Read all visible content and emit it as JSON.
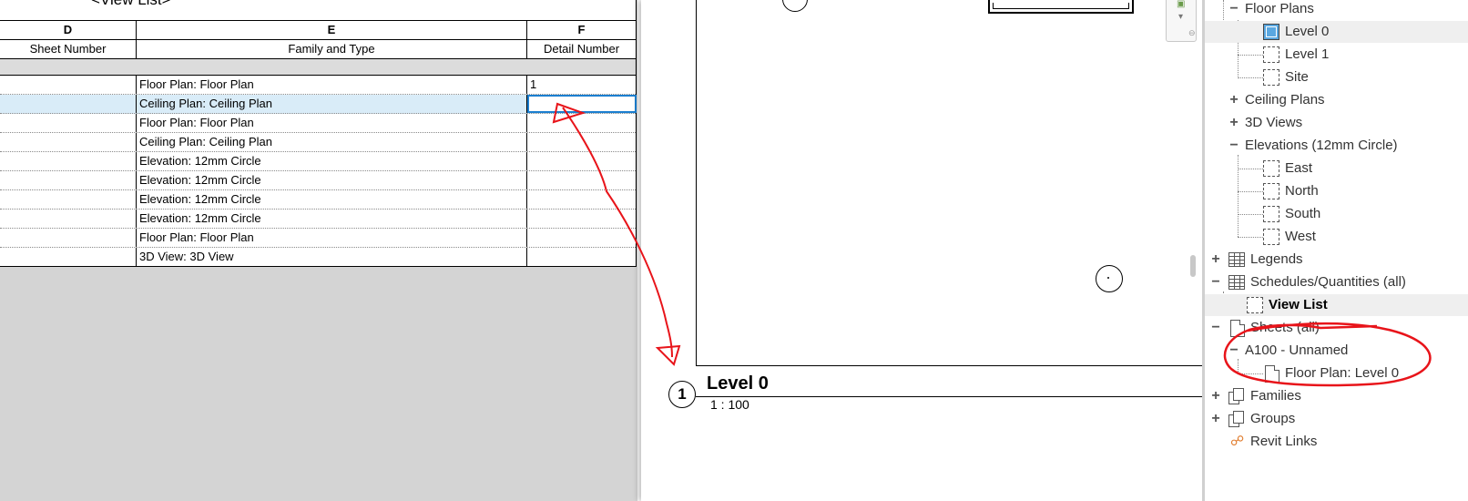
{
  "schedule": {
    "title": "<View List>",
    "column_letters": [
      "D",
      "E",
      "F"
    ],
    "column_names": [
      "Sheet Number",
      "Family and Type",
      "Detail Number"
    ],
    "rows": [
      {
        "sheet_number": "",
        "family_type": "Floor Plan: Floor Plan",
        "detail_number": "1"
      },
      {
        "sheet_number": "",
        "family_type": "Ceiling Plan: Ceiling Plan",
        "detail_number": ""
      },
      {
        "sheet_number": "",
        "family_type": "Floor Plan: Floor Plan",
        "detail_number": ""
      },
      {
        "sheet_number": "",
        "family_type": "Ceiling Plan: Ceiling Plan",
        "detail_number": ""
      },
      {
        "sheet_number": "",
        "family_type": "Elevation: 12mm Circle",
        "detail_number": ""
      },
      {
        "sheet_number": "",
        "family_type": "Elevation: 12mm Circle",
        "detail_number": ""
      },
      {
        "sheet_number": "",
        "family_type": "Elevation: 12mm Circle",
        "detail_number": ""
      },
      {
        "sheet_number": "",
        "family_type": "Elevation: 12mm Circle",
        "detail_number": ""
      },
      {
        "sheet_number": "",
        "family_type": "Floor Plan: Floor Plan",
        "detail_number": ""
      },
      {
        "sheet_number": "",
        "family_type": "3D View: 3D View",
        "detail_number": ""
      }
    ],
    "selected_row": 1
  },
  "sheet": {
    "view_number": "1",
    "view_name": "Level 0",
    "view_scale": "1 : 100"
  },
  "browser": {
    "floor_plans": "Floor Plans",
    "level_0": "Level 0",
    "level_1": "Level 1",
    "site": "Site",
    "ceiling_plans": "Ceiling Plans",
    "views_3d": "3D Views",
    "elevations": "Elevations (12mm Circle)",
    "east": "East",
    "north": "North",
    "south": "South",
    "west": "West",
    "legends": "Legends",
    "schedules": "Schedules/Quantities (all)",
    "view_list": "View List",
    "sheets": "Sheets (all)",
    "sheet_a100": "A100 - Unnamed",
    "sheet_a100_view": "Floor Plan: Level 0",
    "families": "Families",
    "groups": "Groups",
    "revit_links": "Revit Links",
    "expand_symbol": "+",
    "collapse_symbol": "−"
  },
  "colors": {
    "selection_blue": "#1b7fd0",
    "selected_row_bg": "#d9ecf8",
    "annotation_red": "#e8141a",
    "active_view_icon": "#5aa7e0"
  }
}
